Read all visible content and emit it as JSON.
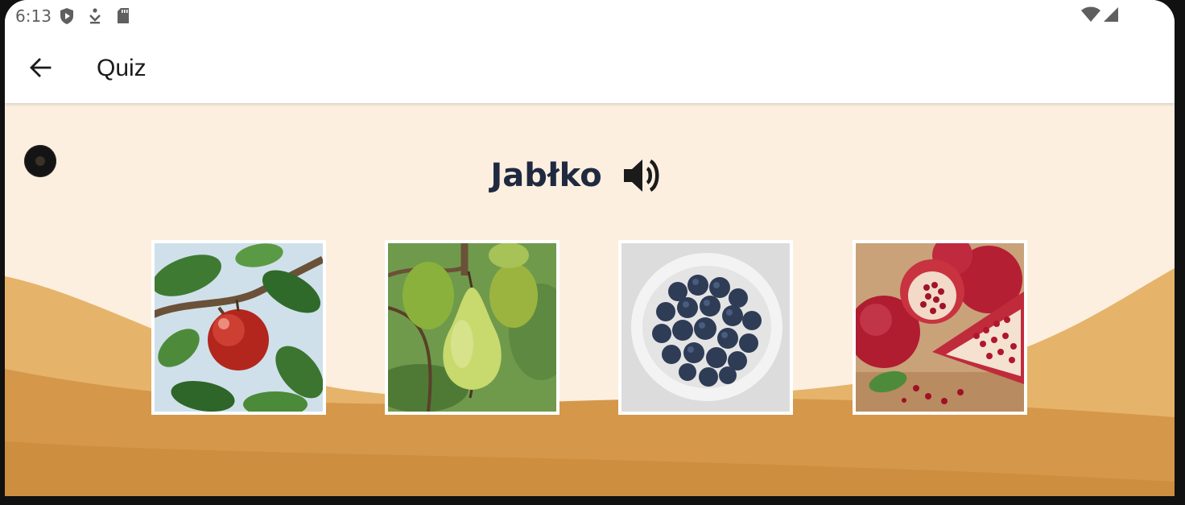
{
  "status_bar": {
    "time": "6:13",
    "icons": [
      "shield-play-icon",
      "download-icon",
      "sd-card-icon",
      "wifi-icon",
      "signal-icon"
    ]
  },
  "app_bar": {
    "back_icon": "arrow-back-icon",
    "title": "Quiz"
  },
  "quiz": {
    "word": "Jabłko",
    "speaker_icon": "volume-up-icon",
    "options": [
      {
        "name": "apple",
        "icon": "apple-image"
      },
      {
        "name": "pear",
        "icon": "pear-image"
      },
      {
        "name": "blueberries",
        "icon": "blueberries-image"
      },
      {
        "name": "pomegranate",
        "icon": "pomegranate-image"
      }
    ]
  },
  "colors": {
    "background": "#fcefdf",
    "hill_light": "#e6b36a",
    "hill_dark": "#cf8f40",
    "word_text": "#1f2a40",
    "card_border": "#ffffff"
  }
}
